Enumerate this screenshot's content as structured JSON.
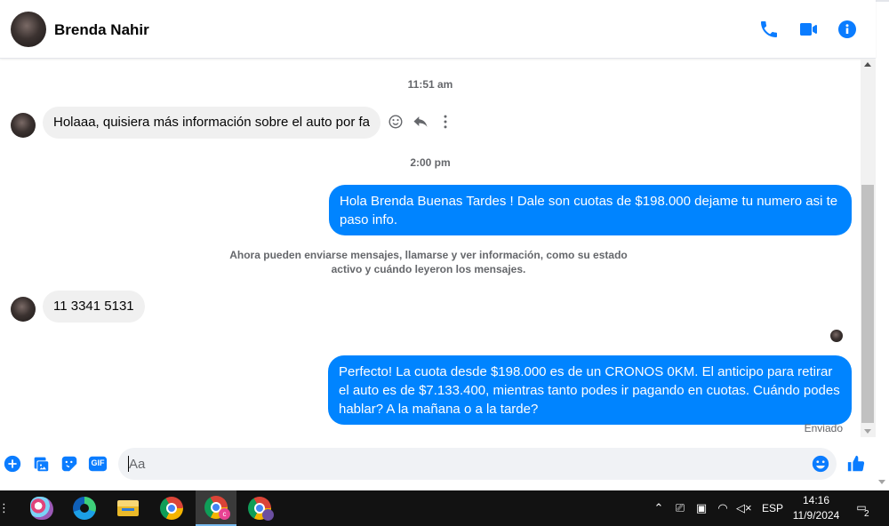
{
  "header": {
    "contact_name": "Brenda Nahir"
  },
  "conversation": {
    "time_1": "11:51 am",
    "incoming_1": "Holaaa, quisiera más información sobre el auto por fa",
    "time_2": "2:00 pm",
    "outgoing_1": "Hola Brenda Buenas Tardes ! Dale son cuotas de $198.000 dejame tu numero asi te paso info.",
    "system_note": "Ahora pueden enviarse mensajes, llamarse y ver información, como su estado activo y cuándo leyeron los mensajes.",
    "incoming_2": "11 3341 5131",
    "outgoing_2": "Perfecto! La cuota desde $198.000 es de un CRONOS 0KM. El anticipo para retirar el auto es de $7.133.400, mientras tanto podes ir pagando en cuotas. Cuándo podes hablar? A la mañana o a la tarde?",
    "status": "Enviado"
  },
  "composer": {
    "placeholder": "Aa",
    "gif_label": "GIF"
  },
  "taskbar": {
    "language": "ESP",
    "time": "14:16",
    "date": "11/9/2024",
    "notification_count": "2"
  },
  "colors": {
    "accent": "#0a7cff",
    "bubble_out": "#0084ff",
    "bubble_in": "#f0f0f0",
    "taskbar": "#121212"
  },
  "icons": {
    "header": [
      "phone-icon",
      "video-camera-icon",
      "info-icon"
    ],
    "message_actions": [
      "emoji-reaction-icon",
      "reply-icon",
      "more-options-icon"
    ],
    "composer": [
      "plus-icon",
      "image-icon",
      "sticker-icon",
      "gif-icon",
      "emoji-icon",
      "thumbs-up-icon"
    ]
  }
}
